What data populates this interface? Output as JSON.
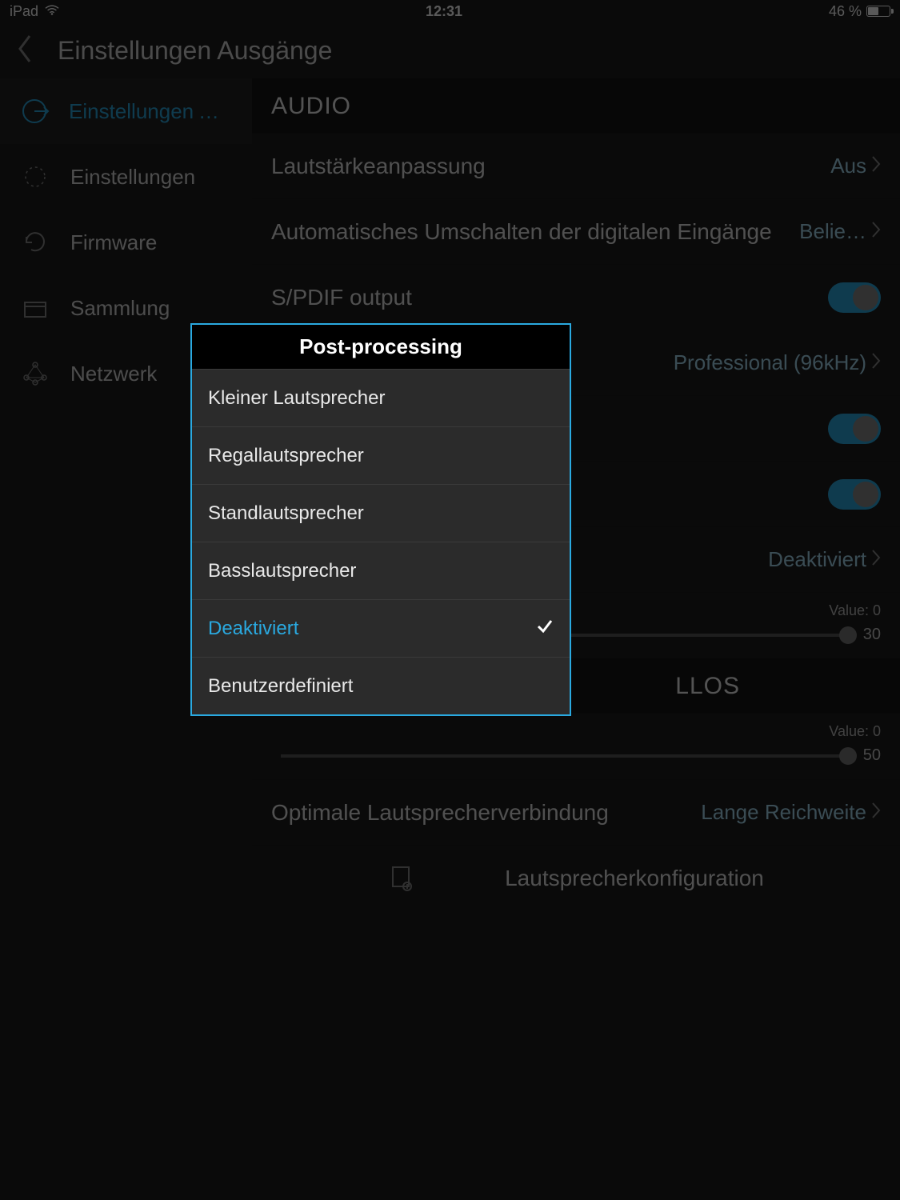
{
  "status": {
    "device": "iPad",
    "time": "12:31",
    "battery_pct": "46 %"
  },
  "header": {
    "title": "Einstellungen Ausgänge"
  },
  "sidebar": {
    "items": [
      {
        "label": "Einstellungen Ausgä…"
      },
      {
        "label": "Einstellungen"
      },
      {
        "label": "Firmware"
      },
      {
        "label": "Sammlung"
      },
      {
        "label": "Netzwerk"
      }
    ]
  },
  "main": {
    "section1": "AUDIO",
    "row_volume": {
      "label": "Lautstärkeanpassung",
      "value": "Aus"
    },
    "row_autoswitch": {
      "label": "Automatisches Umschalten der digitalen Eingänge",
      "value": "Belie…"
    },
    "row_spdif_out": {
      "label": "S/PDIF output"
    },
    "row_spdif_mode": {
      "value": "Professional (96kHz)"
    },
    "row_postproc": {
      "value": "Deaktiviert"
    },
    "slider1": {
      "value_label": "Value: 0",
      "min": "",
      "max": "30"
    },
    "section2": "LLOS",
    "slider2": {
      "value_label": "Value: 0",
      "min": "",
      "max": "50"
    },
    "row_optimal": {
      "label": "Optimale Lautsprecherverbindung",
      "value": "Lange Reichweite"
    },
    "row_config": {
      "label": "Lautsprecherkonfiguration"
    }
  },
  "modal": {
    "title": "Post-processing",
    "options": [
      "Kleiner Lautsprecher",
      "Regallautsprecher",
      "Standlautsprecher",
      "Basslautsprecher",
      "Deaktiviert",
      "Benutzerdefiniert"
    ],
    "selected_index": 4
  }
}
